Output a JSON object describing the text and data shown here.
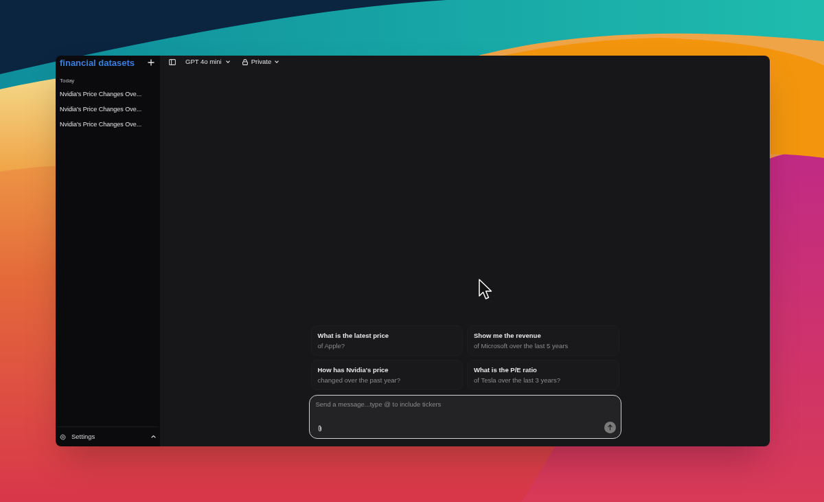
{
  "sidebar": {
    "title": "financial datasets",
    "section": "Today",
    "items": [
      {
        "label": "Nvidia's Price Changes Ove...",
        "selected": false
      },
      {
        "label": "Nvidia's Price Changes Ove...",
        "selected": false
      },
      {
        "label": "Nvidia's Price Changes Ove...",
        "selected": false
      }
    ],
    "settings": {
      "label": "Settings"
    }
  },
  "header": {
    "model": "GPT 4o mini",
    "visibility": "Private"
  },
  "suggestions": [
    {
      "title": "What is the latest price",
      "subtitle": "of Apple?"
    },
    {
      "title": "Show me the revenue",
      "subtitle": "of Microsoft over the last 5 years"
    },
    {
      "title": "How has Nvidia's price",
      "subtitle": "changed over the past year?"
    },
    {
      "title": "What is the P/E ratio",
      "subtitle": "of Tesla over the last 3 years?"
    }
  ],
  "composer": {
    "placeholder": "Send a message...type @ to include tickers"
  }
}
